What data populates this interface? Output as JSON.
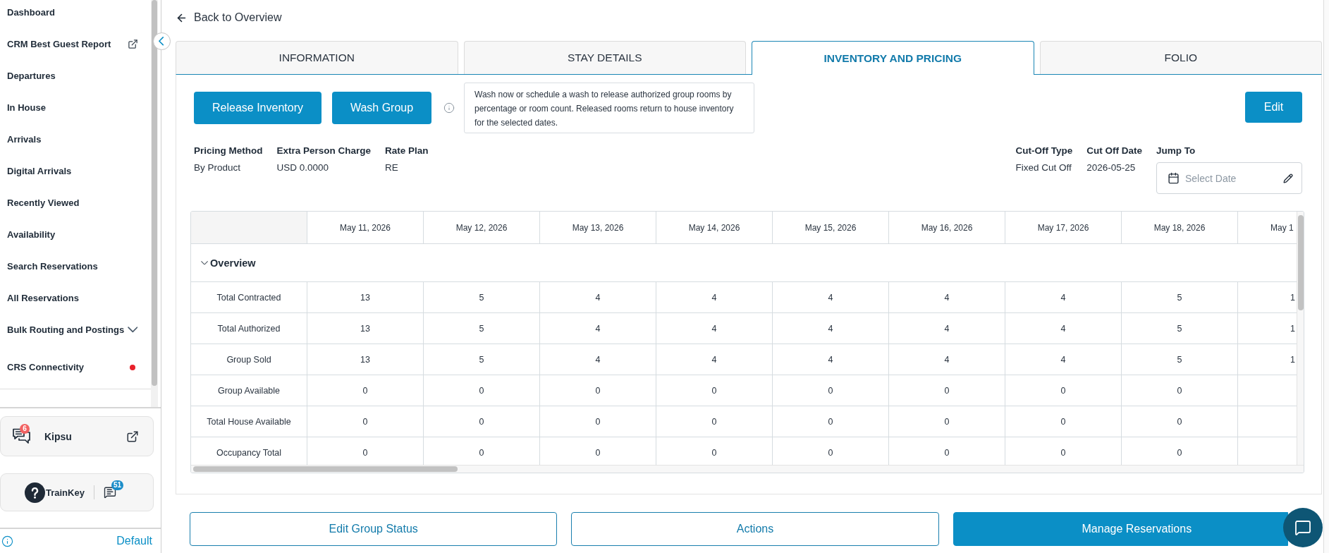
{
  "sidebar": {
    "nav_items": [
      {
        "label": "Dashboard",
        "kind": "link"
      },
      {
        "label": "CRM Best Guest Report",
        "kind": "external"
      },
      {
        "label": "Departures",
        "kind": "link"
      },
      {
        "label": "In House",
        "kind": "link"
      },
      {
        "label": "Arrivals",
        "kind": "link"
      },
      {
        "label": "Digital Arrivals",
        "kind": "link"
      },
      {
        "label": "Recently Viewed",
        "kind": "link"
      },
      {
        "label": "Availability",
        "kind": "link"
      },
      {
        "label": "Search Reservations",
        "kind": "link"
      },
      {
        "label": "All Reservations",
        "kind": "link"
      },
      {
        "label": "Bulk Routing and Postings",
        "kind": "expandable",
        "expanded": false
      },
      {
        "label": "CRS Connectivity",
        "kind": "alert"
      }
    ],
    "apps": [
      {
        "label": "Kipsu",
        "kind": "external",
        "badge": "6"
      },
      {
        "label": "TrainKey",
        "kind": "help",
        "badge": "51"
      }
    ],
    "footer_link": "Default"
  },
  "main": {
    "back_link": "Back to Overview",
    "tabs": [
      {
        "label": "INFORMATION",
        "selected": false
      },
      {
        "label": "STAY DETAILS",
        "selected": false
      },
      {
        "label": "INVENTORY AND PRICING",
        "selected": true
      },
      {
        "label": "FOLIO",
        "selected": false
      }
    ],
    "actions": [
      "Release Inventory",
      "Wash Group"
    ],
    "tooltip": "Wash now or schedule a wash to release authorized group rooms by percentage or room count. Released rooms return to house inventory for the selected dates.",
    "edit_button": "Edit",
    "details": [
      {
        "label": "Pricing Method",
        "value": "By Product"
      },
      {
        "label": "Extra Person Charge",
        "value": "USD 0.0000"
      },
      {
        "label": "Rate Plan",
        "value": "RE"
      }
    ],
    "cutoff": [
      {
        "label": "Cut-Off Type",
        "value": "Fixed Cut Off"
      },
      {
        "label": "Cut Off Date",
        "value": "2026-05-25"
      }
    ],
    "jump_to": {
      "label": "Jump To",
      "placeholder": "Select Date"
    },
    "table": {
      "columns": [
        "May 11, 2026",
        "May 12, 2026",
        "May 13, 2026",
        "May 14, 2026",
        "May 15, 2026",
        "May 16, 2026",
        "May 17, 2026",
        "May 18, 2026",
        "May 1"
      ],
      "sections": [
        {
          "title": "Overview",
          "expanded": true,
          "rows": [
            {
              "label": "Total Contracted",
              "values": [
                "13",
                "5",
                "4",
                "4",
                "4",
                "4",
                "4",
                "5",
                "1"
              ]
            },
            {
              "label": "Total Authorized",
              "values": [
                "13",
                "5",
                "4",
                "4",
                "4",
                "4",
                "4",
                "5",
                "1"
              ]
            },
            {
              "label": "Group Sold",
              "values": [
                "13",
                "5",
                "4",
                "4",
                "4",
                "4",
                "4",
                "5",
                "1"
              ]
            },
            {
              "label": "Group Available",
              "values": [
                "0",
                "0",
                "0",
                "0",
                "0",
                "0",
                "0",
                "0"
              ]
            },
            {
              "label": "Total House Available",
              "values": [
                "0",
                "0",
                "0",
                "0",
                "0",
                "0",
                "0",
                "0"
              ]
            },
            {
              "label": "Occupancy Total",
              "values": [
                "0",
                "0",
                "0",
                "0",
                "0",
                "0",
                "0",
                "0"
              ]
            }
          ]
        }
      ]
    },
    "bottom_buttons": [
      {
        "label": "Edit Group Status",
        "kind": "outline"
      },
      {
        "label": "Actions",
        "kind": "outline"
      },
      {
        "label": "Manage Reservations",
        "kind": "primary"
      }
    ]
  }
}
